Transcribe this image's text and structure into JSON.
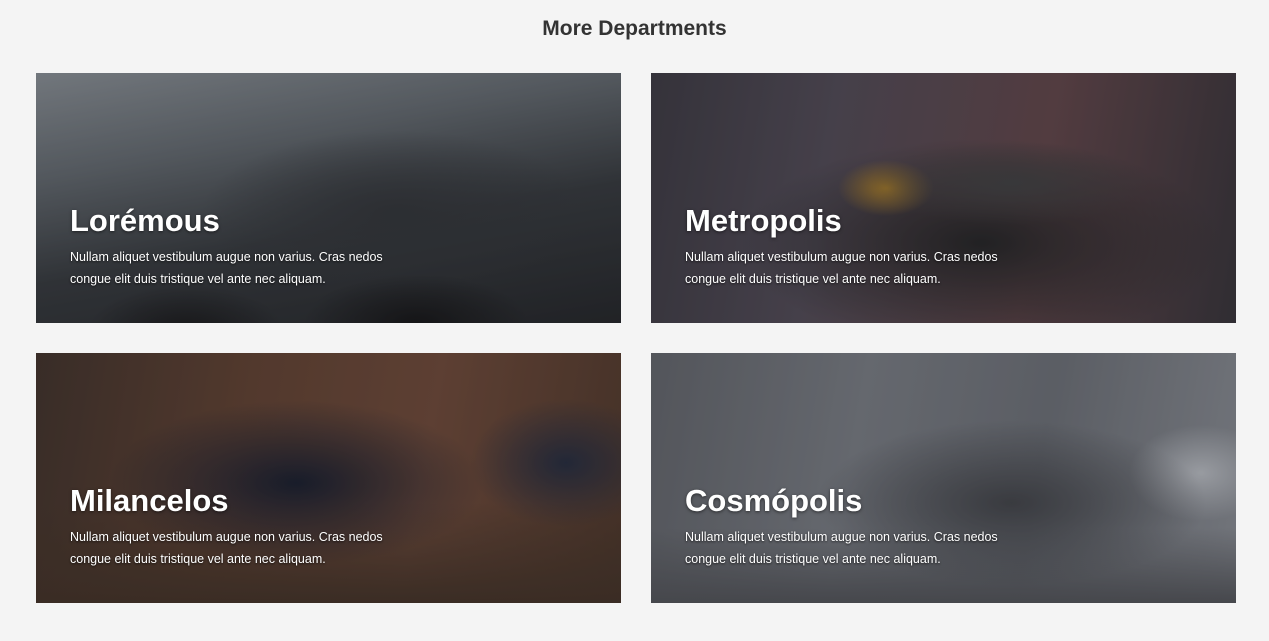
{
  "section": {
    "title": "More Departments"
  },
  "cards": [
    {
      "name": "Lorémous",
      "description": "Nullam aliquet vestibulum augue non varius. Cras nedos congue elit duis tristique vel ante nec aliquam."
    },
    {
      "name": "Metropolis",
      "description": "Nullam aliquet vestibulum augue non varius. Cras nedos congue elit duis tristique vel ante nec aliquam."
    },
    {
      "name": "Milancelos",
      "description": "Nullam aliquet vestibulum augue non varius. Cras nedos congue elit duis tristique vel ante nec aliquam."
    },
    {
      "name": "Cosmópolis",
      "description": "Nullam aliquet vestibulum augue non varius. Cras nedos congue elit duis tristique vel ante nec aliquam."
    }
  ]
}
